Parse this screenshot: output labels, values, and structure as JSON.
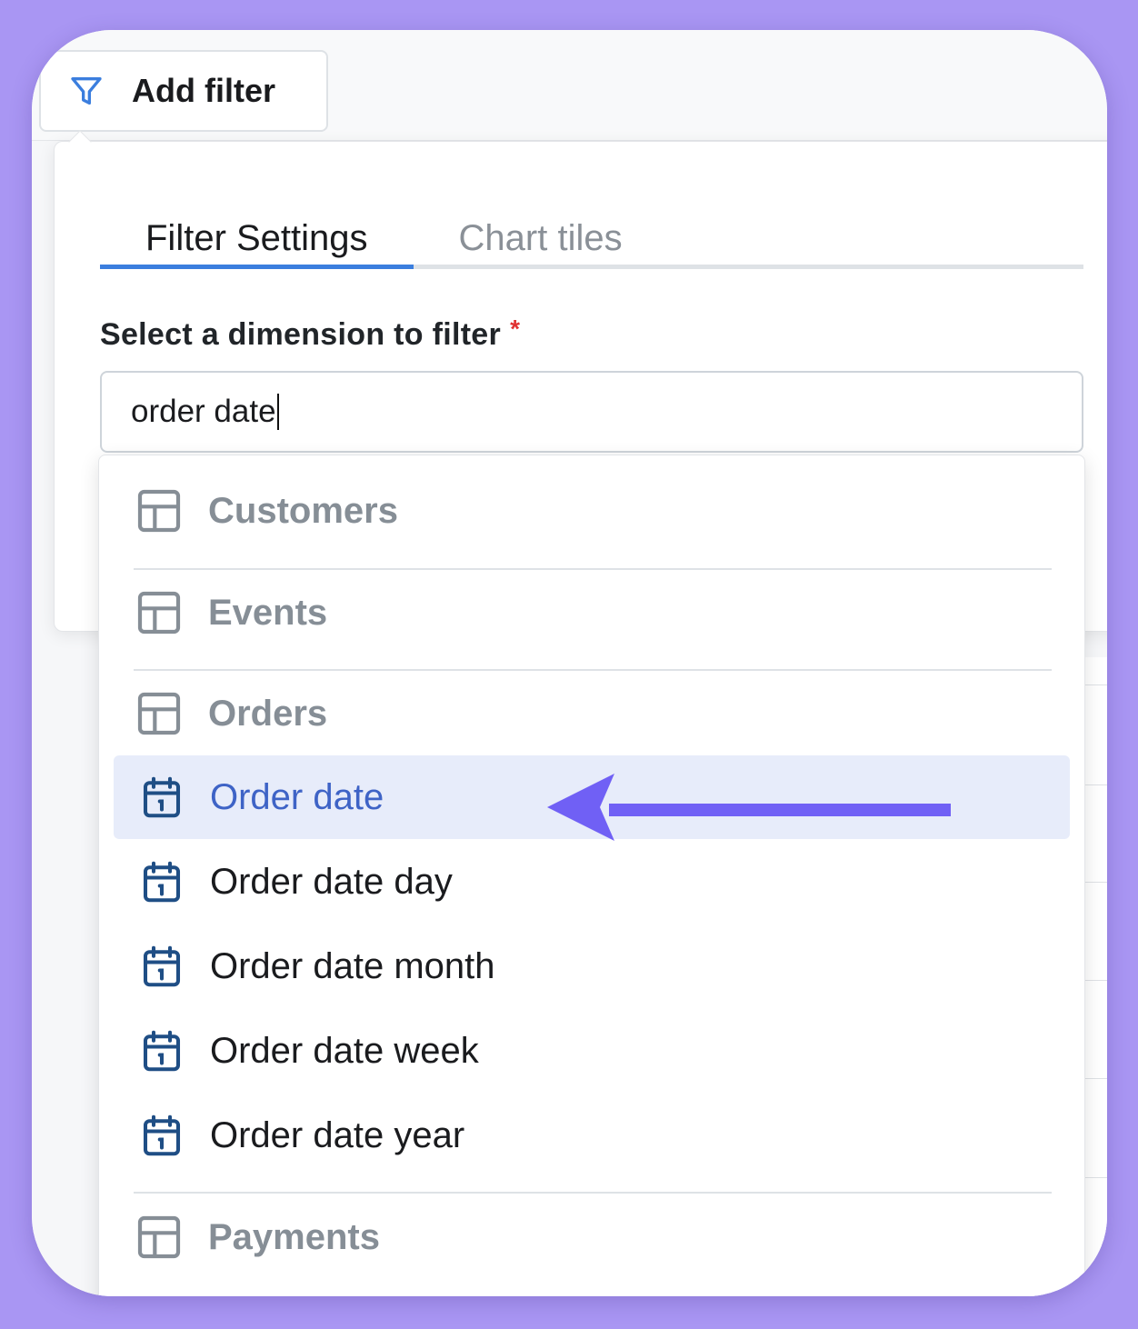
{
  "toolbar": {
    "add_filter_label": "Add filter"
  },
  "tabs": [
    {
      "label": "Filter Settings",
      "active": true
    },
    {
      "label": "Chart tiles",
      "active": false
    }
  ],
  "field": {
    "label": "Select a dimension to filter",
    "required_mark": "*",
    "value": "order date"
  },
  "dropdown": {
    "groups": [
      {
        "label": "Customers",
        "icon": "table-icon"
      },
      {
        "label": "Events",
        "icon": "table-icon"
      },
      {
        "label": "Orders",
        "icon": "table-icon"
      },
      {
        "label": "Payments",
        "icon": "table-icon"
      }
    ],
    "items": [
      {
        "label": "Order date",
        "icon": "calendar-icon",
        "selected": true
      },
      {
        "label": "Order date day",
        "icon": "calendar-icon",
        "selected": false
      },
      {
        "label": "Order date month",
        "icon": "calendar-icon",
        "selected": false
      },
      {
        "label": "Order date week",
        "icon": "calendar-icon",
        "selected": false
      },
      {
        "label": "Order date year",
        "icon": "calendar-icon",
        "selected": false
      }
    ]
  },
  "colors": {
    "background": "#a996f3",
    "accent": "#3b7ede",
    "selected_bg": "#e7ecfa",
    "selected_text": "#3e63c6",
    "annotation_arrow": "#7060f5",
    "required": "#e03131"
  }
}
